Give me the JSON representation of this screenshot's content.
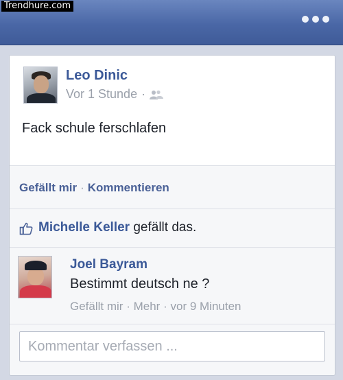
{
  "watermark": "Trendhure.com",
  "topbar": {
    "menu_icon": "more-dots-icon"
  },
  "post": {
    "author": "Leo Dinic",
    "time": "Vor 1 Stunde",
    "time_separator": "·",
    "audience_icon": "friends-icon",
    "text": "Fack schule ferschlafen"
  },
  "actions": {
    "like_label": "Gefällt mir",
    "separator": "·",
    "comment_label": "Kommentieren"
  },
  "likes": {
    "icon": "thumbs-up-icon",
    "liker": "Michelle Keller",
    "suffix": "gefällt das."
  },
  "comment": {
    "author": "Joel Bayram",
    "text": "Bestimmt deutsch ne ?",
    "like_label": "Gefällt mir",
    "sep1": "·",
    "more_label": "Mehr",
    "sep2": "·",
    "time": "vor 9 Minuten"
  },
  "composer": {
    "placeholder": "Kommentar verfassen ..."
  },
  "colors": {
    "brand": "#3b5998",
    "topbar": "#4a67a6",
    "muted": "#9aa0aa"
  }
}
